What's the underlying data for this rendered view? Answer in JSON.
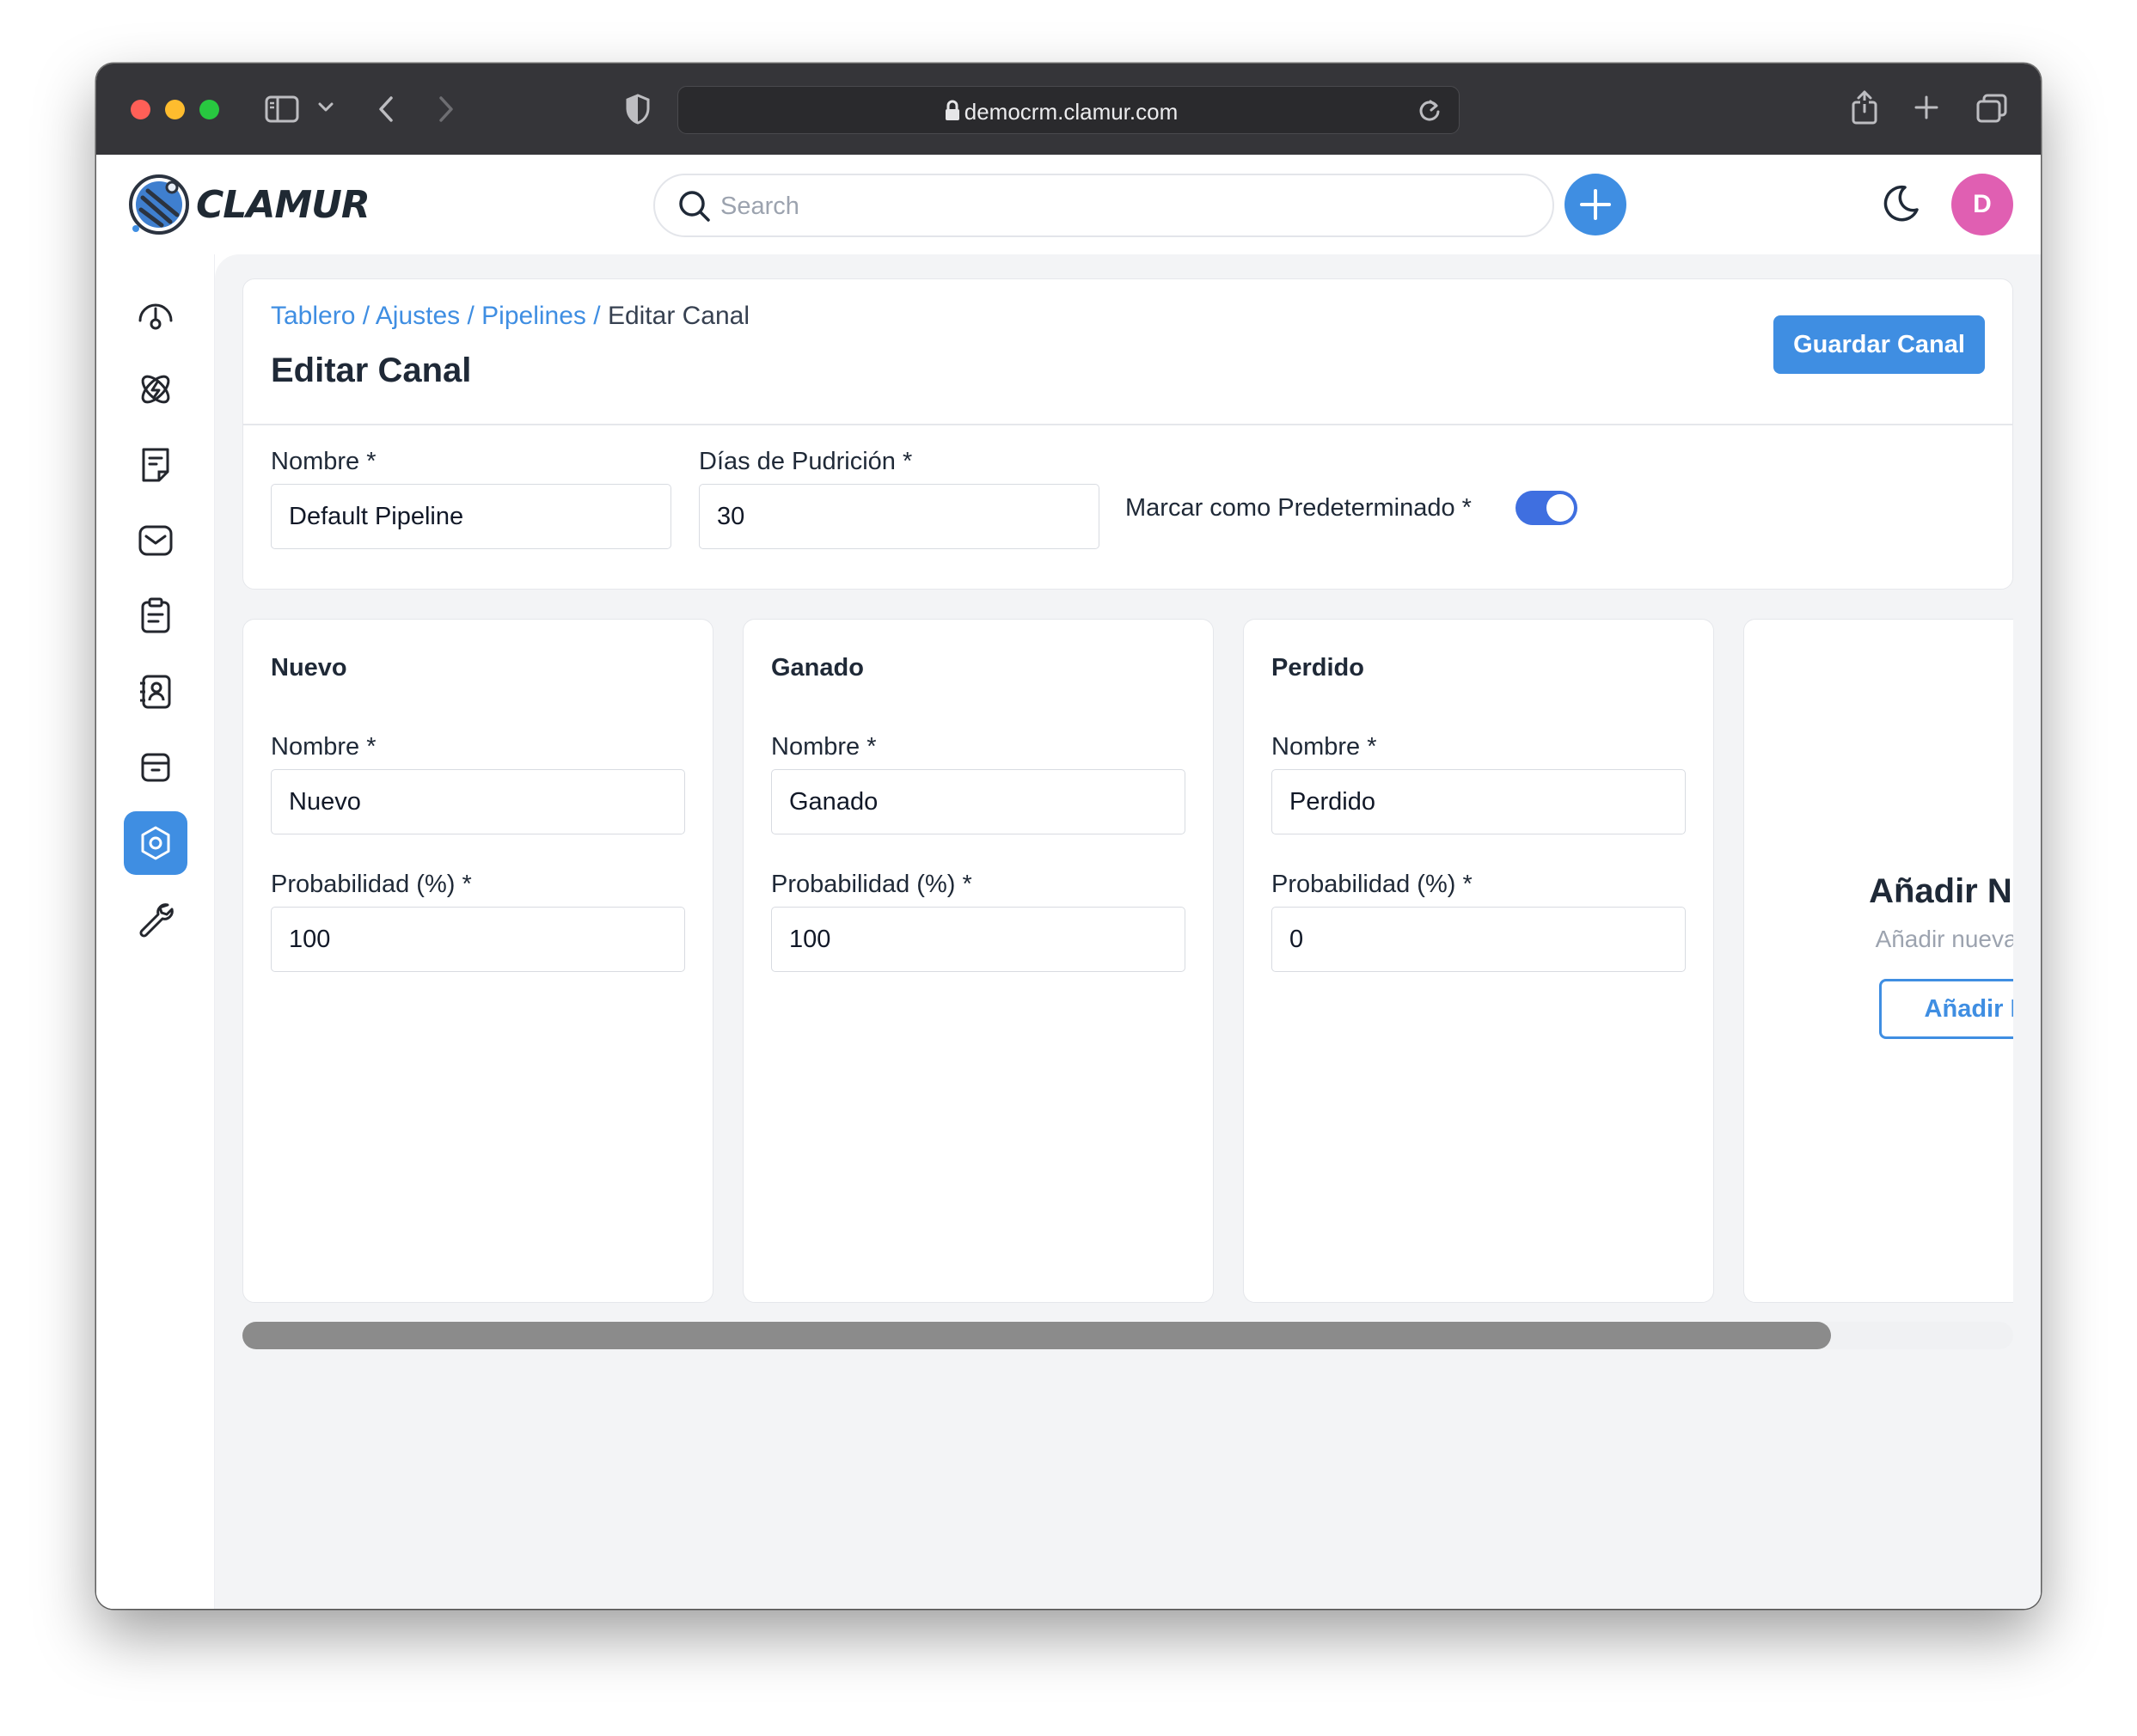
{
  "browser": {
    "url": "democrm.clamur.com"
  },
  "header": {
    "logo_text": "CLAMUR",
    "search_placeholder": "Search",
    "avatar_initial": "D"
  },
  "sidebar": {
    "items": [
      {
        "icon": "dashboard-icon",
        "active": false
      },
      {
        "icon": "leads-icon",
        "active": false
      },
      {
        "icon": "quotes-icon",
        "active": false
      },
      {
        "icon": "mail-icon",
        "active": false
      },
      {
        "icon": "activities-icon",
        "active": false
      },
      {
        "icon": "contacts-icon",
        "active": false
      },
      {
        "icon": "products-icon",
        "active": false
      },
      {
        "icon": "settings-icon",
        "active": true
      },
      {
        "icon": "configuration-icon",
        "active": false
      }
    ]
  },
  "breadcrumb": {
    "items": [
      "Tablero",
      "Ajustes",
      "Pipelines"
    ],
    "separator": " / ",
    "current": "Editar Canal"
  },
  "page": {
    "title": "Editar Canal",
    "save_label": "Guardar Canal"
  },
  "pipeline": {
    "name_label": "Nombre *",
    "name_value": "Default Pipeline",
    "rotten_label": "Días de Pudrición *",
    "rotten_value": "30",
    "default_label": "Marcar como Predeterminado *",
    "default_on": true
  },
  "stages": [
    {
      "title": "Nuevo",
      "name_label": "Nombre *",
      "name": "Nuevo",
      "prob_label": "Probabilidad (%) *",
      "probability": "100"
    },
    {
      "title": "Ganado",
      "name_label": "Nombre *",
      "name": "Ganado",
      "prob_label": "Probabilidad (%) *",
      "probability": "100"
    },
    {
      "title": "Perdido",
      "name_label": "Nombre *",
      "name": "Perdido",
      "prob_label": "Probabilidad (%) *",
      "probability": "0"
    }
  ],
  "add_stage": {
    "title": "Añadir Nueva",
    "subtitle": "Añadir nueva etapa",
    "button": "Añadir Et"
  },
  "colors": {
    "accent": "#3f8ee2",
    "toggle": "#3f6fe0",
    "avatar": "#e05fb2"
  }
}
